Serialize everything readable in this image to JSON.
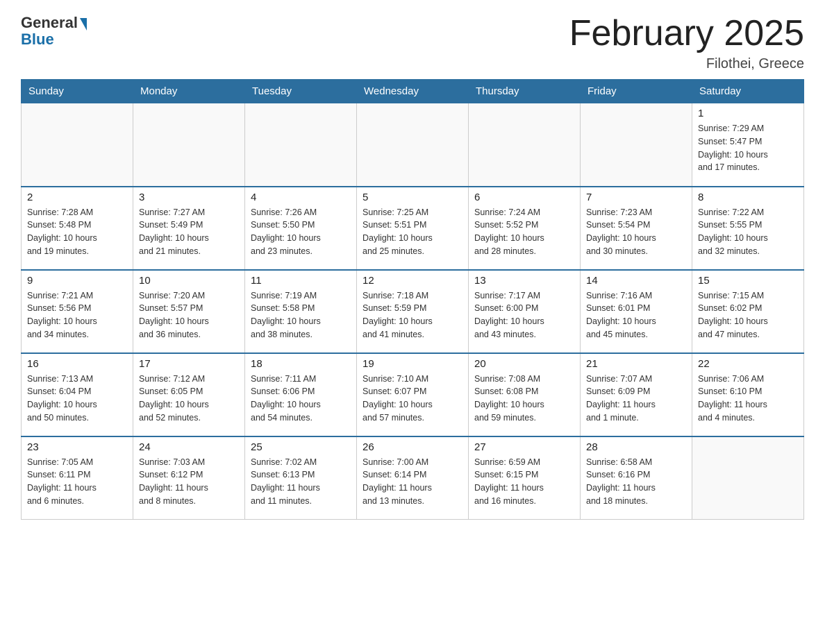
{
  "header": {
    "logo_general": "General",
    "logo_blue": "Blue",
    "month_title": "February 2025",
    "location": "Filothei, Greece"
  },
  "weekdays": [
    "Sunday",
    "Monday",
    "Tuesday",
    "Wednesday",
    "Thursday",
    "Friday",
    "Saturday"
  ],
  "weeks": [
    [
      {
        "day": "",
        "info": ""
      },
      {
        "day": "",
        "info": ""
      },
      {
        "day": "",
        "info": ""
      },
      {
        "day": "",
        "info": ""
      },
      {
        "day": "",
        "info": ""
      },
      {
        "day": "",
        "info": ""
      },
      {
        "day": "1",
        "info": "Sunrise: 7:29 AM\nSunset: 5:47 PM\nDaylight: 10 hours\nand 17 minutes."
      }
    ],
    [
      {
        "day": "2",
        "info": "Sunrise: 7:28 AM\nSunset: 5:48 PM\nDaylight: 10 hours\nand 19 minutes."
      },
      {
        "day": "3",
        "info": "Sunrise: 7:27 AM\nSunset: 5:49 PM\nDaylight: 10 hours\nand 21 minutes."
      },
      {
        "day": "4",
        "info": "Sunrise: 7:26 AM\nSunset: 5:50 PM\nDaylight: 10 hours\nand 23 minutes."
      },
      {
        "day": "5",
        "info": "Sunrise: 7:25 AM\nSunset: 5:51 PM\nDaylight: 10 hours\nand 25 minutes."
      },
      {
        "day": "6",
        "info": "Sunrise: 7:24 AM\nSunset: 5:52 PM\nDaylight: 10 hours\nand 28 minutes."
      },
      {
        "day": "7",
        "info": "Sunrise: 7:23 AM\nSunset: 5:54 PM\nDaylight: 10 hours\nand 30 minutes."
      },
      {
        "day": "8",
        "info": "Sunrise: 7:22 AM\nSunset: 5:55 PM\nDaylight: 10 hours\nand 32 minutes."
      }
    ],
    [
      {
        "day": "9",
        "info": "Sunrise: 7:21 AM\nSunset: 5:56 PM\nDaylight: 10 hours\nand 34 minutes."
      },
      {
        "day": "10",
        "info": "Sunrise: 7:20 AM\nSunset: 5:57 PM\nDaylight: 10 hours\nand 36 minutes."
      },
      {
        "day": "11",
        "info": "Sunrise: 7:19 AM\nSunset: 5:58 PM\nDaylight: 10 hours\nand 38 minutes."
      },
      {
        "day": "12",
        "info": "Sunrise: 7:18 AM\nSunset: 5:59 PM\nDaylight: 10 hours\nand 41 minutes."
      },
      {
        "day": "13",
        "info": "Sunrise: 7:17 AM\nSunset: 6:00 PM\nDaylight: 10 hours\nand 43 minutes."
      },
      {
        "day": "14",
        "info": "Sunrise: 7:16 AM\nSunset: 6:01 PM\nDaylight: 10 hours\nand 45 minutes."
      },
      {
        "day": "15",
        "info": "Sunrise: 7:15 AM\nSunset: 6:02 PM\nDaylight: 10 hours\nand 47 minutes."
      }
    ],
    [
      {
        "day": "16",
        "info": "Sunrise: 7:13 AM\nSunset: 6:04 PM\nDaylight: 10 hours\nand 50 minutes."
      },
      {
        "day": "17",
        "info": "Sunrise: 7:12 AM\nSunset: 6:05 PM\nDaylight: 10 hours\nand 52 minutes."
      },
      {
        "day": "18",
        "info": "Sunrise: 7:11 AM\nSunset: 6:06 PM\nDaylight: 10 hours\nand 54 minutes."
      },
      {
        "day": "19",
        "info": "Sunrise: 7:10 AM\nSunset: 6:07 PM\nDaylight: 10 hours\nand 57 minutes."
      },
      {
        "day": "20",
        "info": "Sunrise: 7:08 AM\nSunset: 6:08 PM\nDaylight: 10 hours\nand 59 minutes."
      },
      {
        "day": "21",
        "info": "Sunrise: 7:07 AM\nSunset: 6:09 PM\nDaylight: 11 hours\nand 1 minute."
      },
      {
        "day": "22",
        "info": "Sunrise: 7:06 AM\nSunset: 6:10 PM\nDaylight: 11 hours\nand 4 minutes."
      }
    ],
    [
      {
        "day": "23",
        "info": "Sunrise: 7:05 AM\nSunset: 6:11 PM\nDaylight: 11 hours\nand 6 minutes."
      },
      {
        "day": "24",
        "info": "Sunrise: 7:03 AM\nSunset: 6:12 PM\nDaylight: 11 hours\nand 8 minutes."
      },
      {
        "day": "25",
        "info": "Sunrise: 7:02 AM\nSunset: 6:13 PM\nDaylight: 11 hours\nand 11 minutes."
      },
      {
        "day": "26",
        "info": "Sunrise: 7:00 AM\nSunset: 6:14 PM\nDaylight: 11 hours\nand 13 minutes."
      },
      {
        "day": "27",
        "info": "Sunrise: 6:59 AM\nSunset: 6:15 PM\nDaylight: 11 hours\nand 16 minutes."
      },
      {
        "day": "28",
        "info": "Sunrise: 6:58 AM\nSunset: 6:16 PM\nDaylight: 11 hours\nand 18 minutes."
      },
      {
        "day": "",
        "info": ""
      }
    ]
  ]
}
